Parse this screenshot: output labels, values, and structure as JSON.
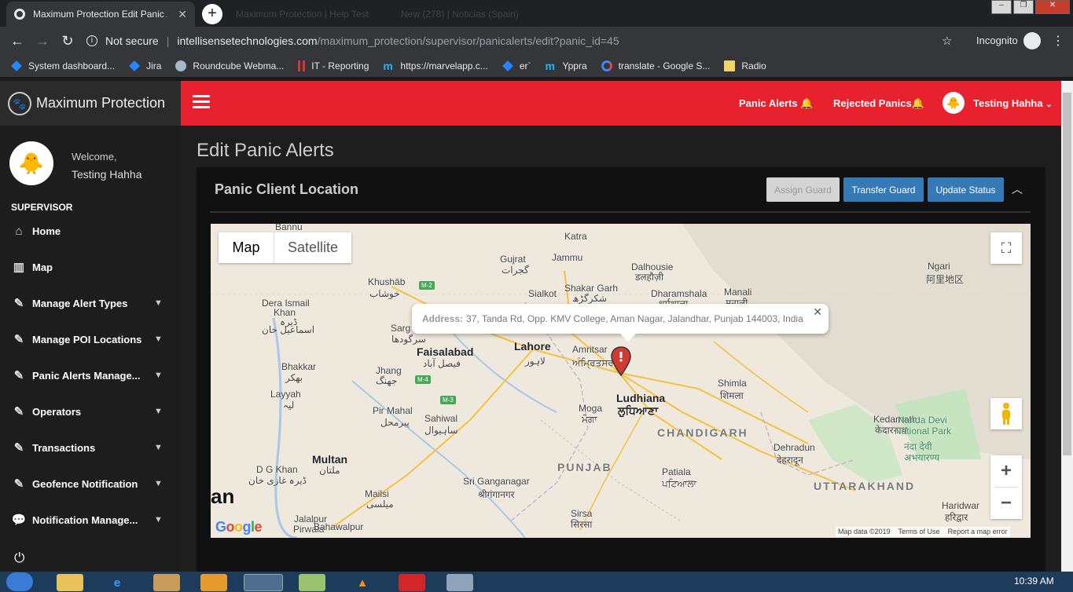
{
  "browser": {
    "tab_title": "Maximum Protection Edit Panic Alerts",
    "inactive_tabs": [
      "Maximum Protection | Help Test",
      "New (278) | Noticias (Spain)"
    ],
    "secure_label": "Not secure",
    "url_host": "intellisensetechnologies.com",
    "url_path": "/maximum_protection/supervisor/panicalerts/edit?panic_id=45",
    "incognito_label": "Incognito",
    "bookmarks": [
      {
        "label": "System dashboard..."
      },
      {
        "label": "Jira"
      },
      {
        "label": "Roundcube Webma..."
      },
      {
        "label": "IT - Reporting"
      },
      {
        "label": "https://marvelapp.c..."
      },
      {
        "label": "er`"
      },
      {
        "label": "Yppra"
      },
      {
        "label": "translate - Google S..."
      },
      {
        "label": "Radio"
      }
    ]
  },
  "brand": {
    "name": "Maximum Protection"
  },
  "user": {
    "welcome": "Welcome,",
    "name": "Testing Hahha"
  },
  "sidebar": {
    "section": "SUPERVISOR",
    "items": [
      {
        "label": "Home",
        "icon": "home-icon",
        "has_submenu": false
      },
      {
        "label": "Map",
        "icon": "map-icon",
        "has_submenu": false
      },
      {
        "label": "Manage Alert Types",
        "icon": "edit-icon",
        "has_submenu": true
      },
      {
        "label": "Manage POI Locations",
        "icon": "edit-icon",
        "has_submenu": true
      },
      {
        "label": "Panic Alerts Manage...",
        "icon": "edit-icon",
        "has_submenu": true
      },
      {
        "label": "Operators",
        "icon": "edit-icon",
        "has_submenu": true
      },
      {
        "label": "Transactions",
        "icon": "edit-icon",
        "has_submenu": true
      },
      {
        "label": "Geofence Notification",
        "icon": "edit-icon",
        "has_submenu": true
      },
      {
        "label": "Notification Manage...",
        "icon": "chat-icon",
        "has_submenu": true
      }
    ]
  },
  "header": {
    "panic_alerts": "Panic Alerts",
    "rejected_panics": "Rejected Panics",
    "user_name": "Testing Hahha"
  },
  "main": {
    "page_title": "Edit Panic Alerts",
    "box_title": "Panic Client Location",
    "buttons": {
      "assign": "Assign Guard",
      "transfer": "Transfer Guard",
      "update": "Update Status"
    }
  },
  "map": {
    "toggle_map": "Map",
    "toggle_satellite": "Satellite",
    "info_label": "Address:",
    "info_address": "37, Tanda Rd, Opp. KMV College, Aman Nagar, Jalandhar, Punjab 144003, India",
    "attribution": {
      "data": "Map data ©2019",
      "terms": "Terms of Use",
      "report": "Report a map error"
    },
    "google": "Google",
    "labels": [
      {
        "text": "Bannu",
        "cls": ""
      },
      {
        "text": "Katra",
        "cls": ""
      },
      {
        "text": "Gujrat",
        "cls": ""
      },
      {
        "text": "گجرات",
        "cls": ""
      },
      {
        "text": "Jammu",
        "cls": ""
      },
      {
        "text": "Dalhousie",
        "cls": ""
      },
      {
        "text": "डलहौज़ी",
        "cls": ""
      },
      {
        "text": "Ngari",
        "cls": ""
      },
      {
        "text": "阿里地区",
        "cls": ""
      },
      {
        "text": "Khushāb",
        "cls": ""
      },
      {
        "text": "خوشاب",
        "cls": ""
      },
      {
        "text": "Shakar Garh",
        "cls": ""
      },
      {
        "text": "شکرگڑھ",
        "cls": ""
      },
      {
        "text": "Sialkot",
        "cls": ""
      },
      {
        "text": "Dharamshala",
        "cls": ""
      },
      {
        "text": "धर्मशाला",
        "cls": ""
      },
      {
        "text": "Manali",
        "cls": ""
      },
      {
        "text": "मनाली",
        "cls": ""
      },
      {
        "text": "Dera Ismail",
        "cls": ""
      },
      {
        "text": "Khan",
        "cls": ""
      },
      {
        "text": "ڈیرہ",
        "cls": ""
      },
      {
        "text": "اسماعیل خان",
        "cls": ""
      },
      {
        "text": "Sarg",
        "cls": ""
      },
      {
        "text": "سرگودھا",
        "cls": ""
      },
      {
        "text": "Lahore",
        "cls": "big"
      },
      {
        "text": "Faisalabad",
        "cls": "big"
      },
      {
        "text": "فیصل آباد",
        "cls": ""
      },
      {
        "text": "لاہور",
        "cls": ""
      },
      {
        "text": "Amritsar",
        "cls": ""
      },
      {
        "text": "ਅੰਮ੍ਰਿਤਸਰ",
        "cls": ""
      },
      {
        "text": "Bhakkar",
        "cls": ""
      },
      {
        "text": "بھکر",
        "cls": ""
      },
      {
        "text": "Jhang",
        "cls": ""
      },
      {
        "text": "جھنگ",
        "cls": ""
      },
      {
        "text": "Ludhiana",
        "cls": "big"
      },
      {
        "text": "ਲੁਧਿਆਣਾ",
        "cls": "big"
      },
      {
        "text": "Shimla",
        "cls": ""
      },
      {
        "text": "शिमला",
        "cls": ""
      },
      {
        "text": "Layyah",
        "cls": ""
      },
      {
        "text": "لیہ",
        "cls": ""
      },
      {
        "text": "Pir Mahal",
        "cls": ""
      },
      {
        "text": "پیرمحل",
        "cls": ""
      },
      {
        "text": "Sahiwal",
        "cls": ""
      },
      {
        "text": "ساہیوال",
        "cls": ""
      },
      {
        "text": "Moga",
        "cls": ""
      },
      {
        "text": "ਮੋਗਾ",
        "cls": ""
      },
      {
        "text": "CHANDIGARH",
        "cls": "region"
      },
      {
        "text": "Kedarnath",
        "cls": ""
      },
      {
        "text": "केदारनाथ",
        "cls": ""
      },
      {
        "text": "Nanda Devi",
        "cls": "green"
      },
      {
        "text": "National Park",
        "cls": "green"
      },
      {
        "text": "नंदा देवी",
        "cls": "green"
      },
      {
        "text": "अभयारण्य",
        "cls": "green"
      },
      {
        "text": "Dehradun",
        "cls": ""
      },
      {
        "text": "देहरादून",
        "cls": ""
      },
      {
        "text": "Multan",
        "cls": "big"
      },
      {
        "text": "ملتان",
        "cls": ""
      },
      {
        "text": "D G Khan",
        "cls": ""
      },
      {
        "text": "ڈیرہ غازی خان",
        "cls": ""
      },
      {
        "text": "PUNJAB",
        "cls": "region"
      },
      {
        "text": "Patiala",
        "cls": ""
      },
      {
        "text": "ਪਟਿਆਲਾ",
        "cls": ""
      },
      {
        "text": "UTTARAKHAND",
        "cls": "region"
      },
      {
        "text": "Sri Ganganagar",
        "cls": ""
      },
      {
        "text": "श्रीगंगानगर",
        "cls": ""
      },
      {
        "text": "Mailsi",
        "cls": ""
      },
      {
        "text": "میلسی",
        "cls": ""
      },
      {
        "text": "Haridwar",
        "cls": ""
      },
      {
        "text": "हरिद्वार",
        "cls": ""
      },
      {
        "text": "Jalalpur",
        "cls": ""
      },
      {
        "text": "Pirwala",
        "cls": ""
      },
      {
        "text": "Bahawalpur",
        "cls": ""
      },
      {
        "text": "Sirsa",
        "cls": ""
      },
      {
        "text": "सिरसा",
        "cls": ""
      },
      {
        "text": "an",
        "cls": "big"
      }
    ],
    "shields": [
      "M-2",
      "M-4",
      "M-3"
    ]
  },
  "taskbar": {
    "time": "10:39 AM"
  }
}
